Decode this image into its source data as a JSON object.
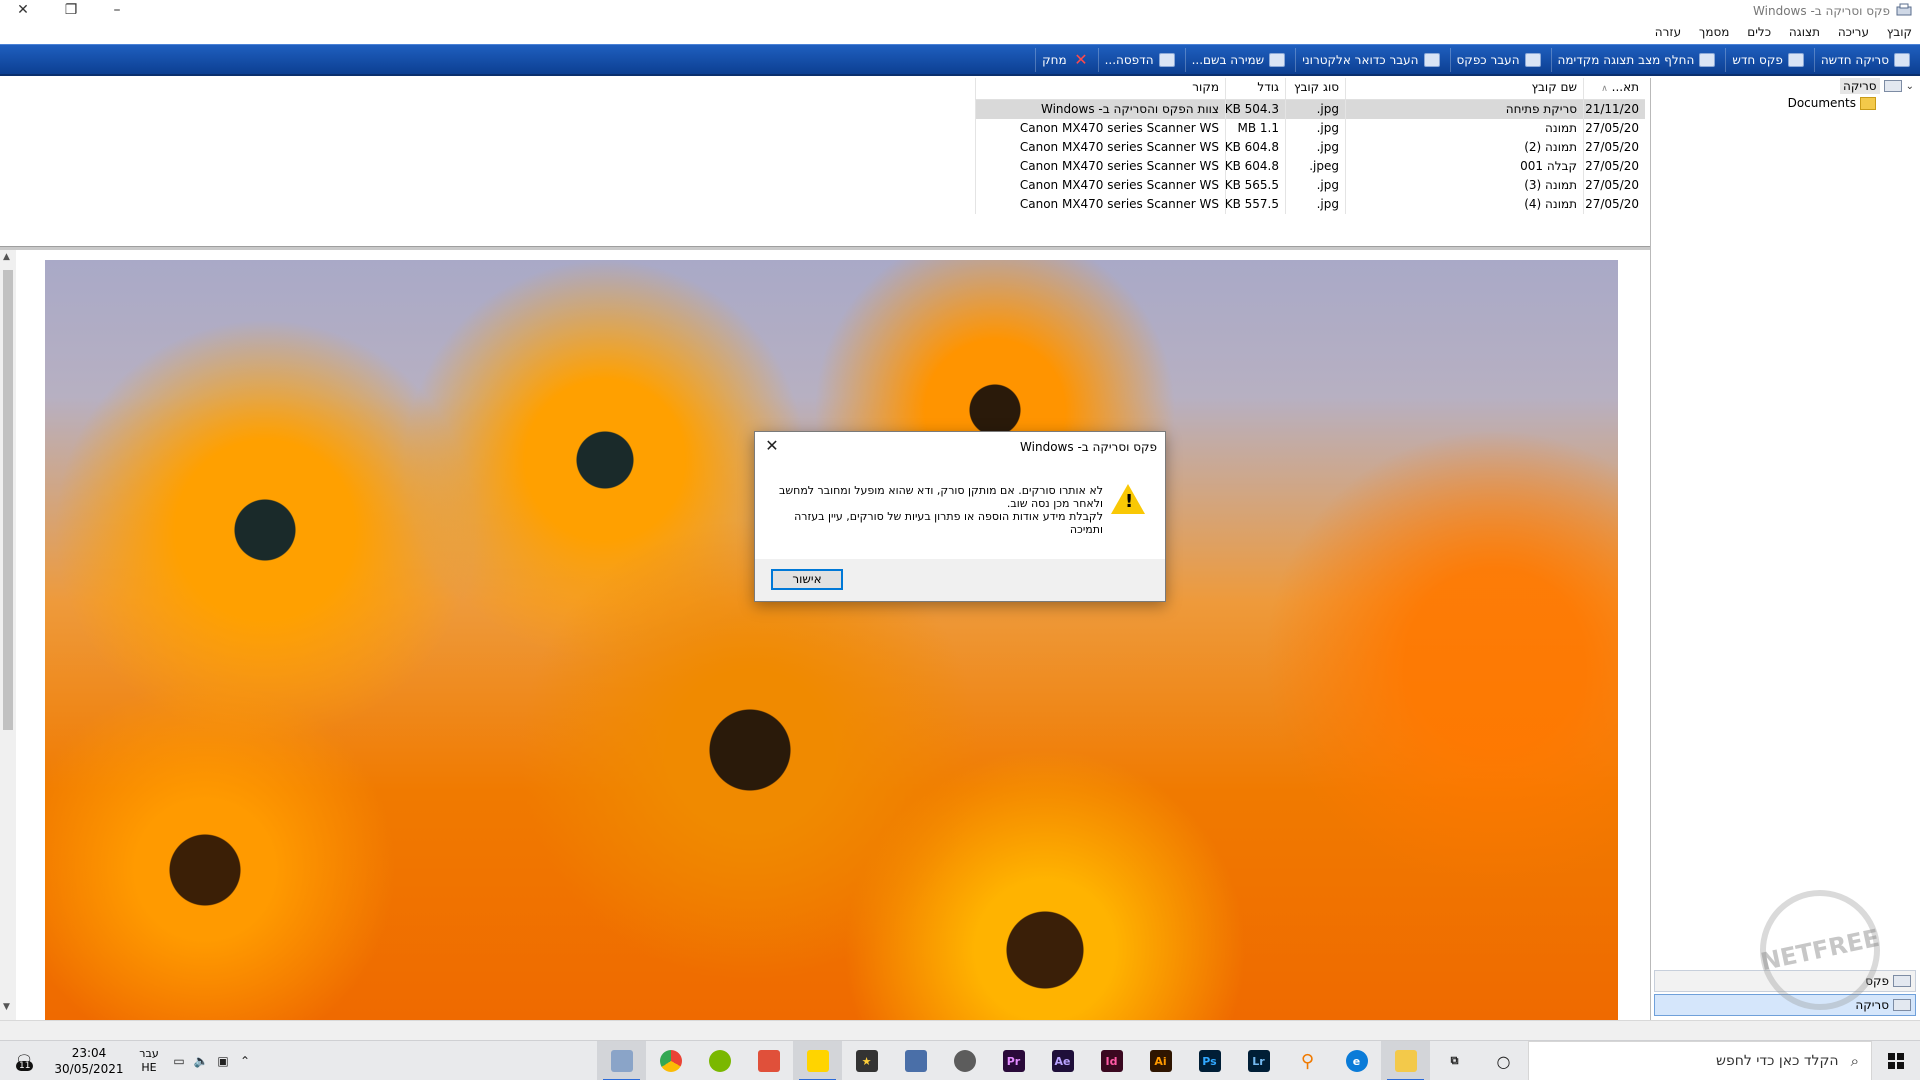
{
  "window": {
    "title": "פקס וסריקה ב- Windows",
    "controls": {
      "minimize": "–",
      "restore": "❐",
      "close": "✕"
    }
  },
  "menu": [
    "קובץ",
    "עריכה",
    "תצוגה",
    "כלים",
    "מסמך",
    "עזרה"
  ],
  "toolbar": {
    "new_scan": "סריקה חדשה",
    "new_fax": "פקס חדש",
    "toggle_preview": "החלף מצב תצוגה מקדימה",
    "forward_fax": "העבר כפקס",
    "forward_email": "העבר כדואר אלקטרוני",
    "save_as": "שמירה בשם...",
    "print": "הדפסה...",
    "delete": "מחק"
  },
  "nav": {
    "root": "סריקה",
    "documents": "Documents",
    "bottom_fax": "פקס",
    "bottom_scan": "סריקה"
  },
  "file_list": {
    "columns": {
      "date": "תא...",
      "name": "שם קובץ",
      "type": "סוג קובץ",
      "size": "גודל",
      "source": "מקור"
    },
    "rows": [
      {
        "date": "21/11/20...",
        "name": "סריקת פתיחה",
        "type": "jpg.",
        "size": "504.3 KB",
        "source": "צוות הפקס והסריקה ב- Windows"
      },
      {
        "date": "27/05/20...",
        "name": "תמונה",
        "type": "jpg.",
        "size": "1.1 MB",
        "source": "Canon MX470 series Scanner WS"
      },
      {
        "date": "27/05/20...",
        "name": "תמונה (2)",
        "type": "jpg.",
        "size": "604.8 KB",
        "source": "Canon MX470 series Scanner WS"
      },
      {
        "date": "27/05/20...",
        "name": "קבלה 001",
        "type": "jpeg.",
        "size": "604.8 KB",
        "source": "Canon MX470 series Scanner WS"
      },
      {
        "date": "27/05/20...",
        "name": "תמונה (3)",
        "type": "jpg.",
        "size": "565.5 KB",
        "source": "Canon MX470 series Scanner WS"
      },
      {
        "date": "27/05/20...",
        "name": "תמונה (4)",
        "type": "jpg.",
        "size": "557.5 KB",
        "source": "Canon MX470 series Scanner WS"
      }
    ]
  },
  "dialog": {
    "title": "פקס וסריקה ב- Windows",
    "line1": "לא אותרו סורקים. אם מותקן סורק, ודא שהוא מופעל ומחובר למחשב ולאחר מכן נסה שוב.",
    "line2": "לקבלת מידע אודות הוספה או פתרון בעיות של סורקים, עיין בעזרה ותמיכה",
    "ok": "אישור"
  },
  "watermark": "NETFREE",
  "taskbar": {
    "search_placeholder": "הקלד כאן כדי לחפש",
    "time": "23:04",
    "date": "30/05/2021",
    "lang_top": "עבר",
    "lang_bottom": "HE",
    "notification_count": "11",
    "apps": [
      "Pr",
      "Ae",
      "Id",
      "Ai",
      "Ps",
      "Lr"
    ]
  }
}
